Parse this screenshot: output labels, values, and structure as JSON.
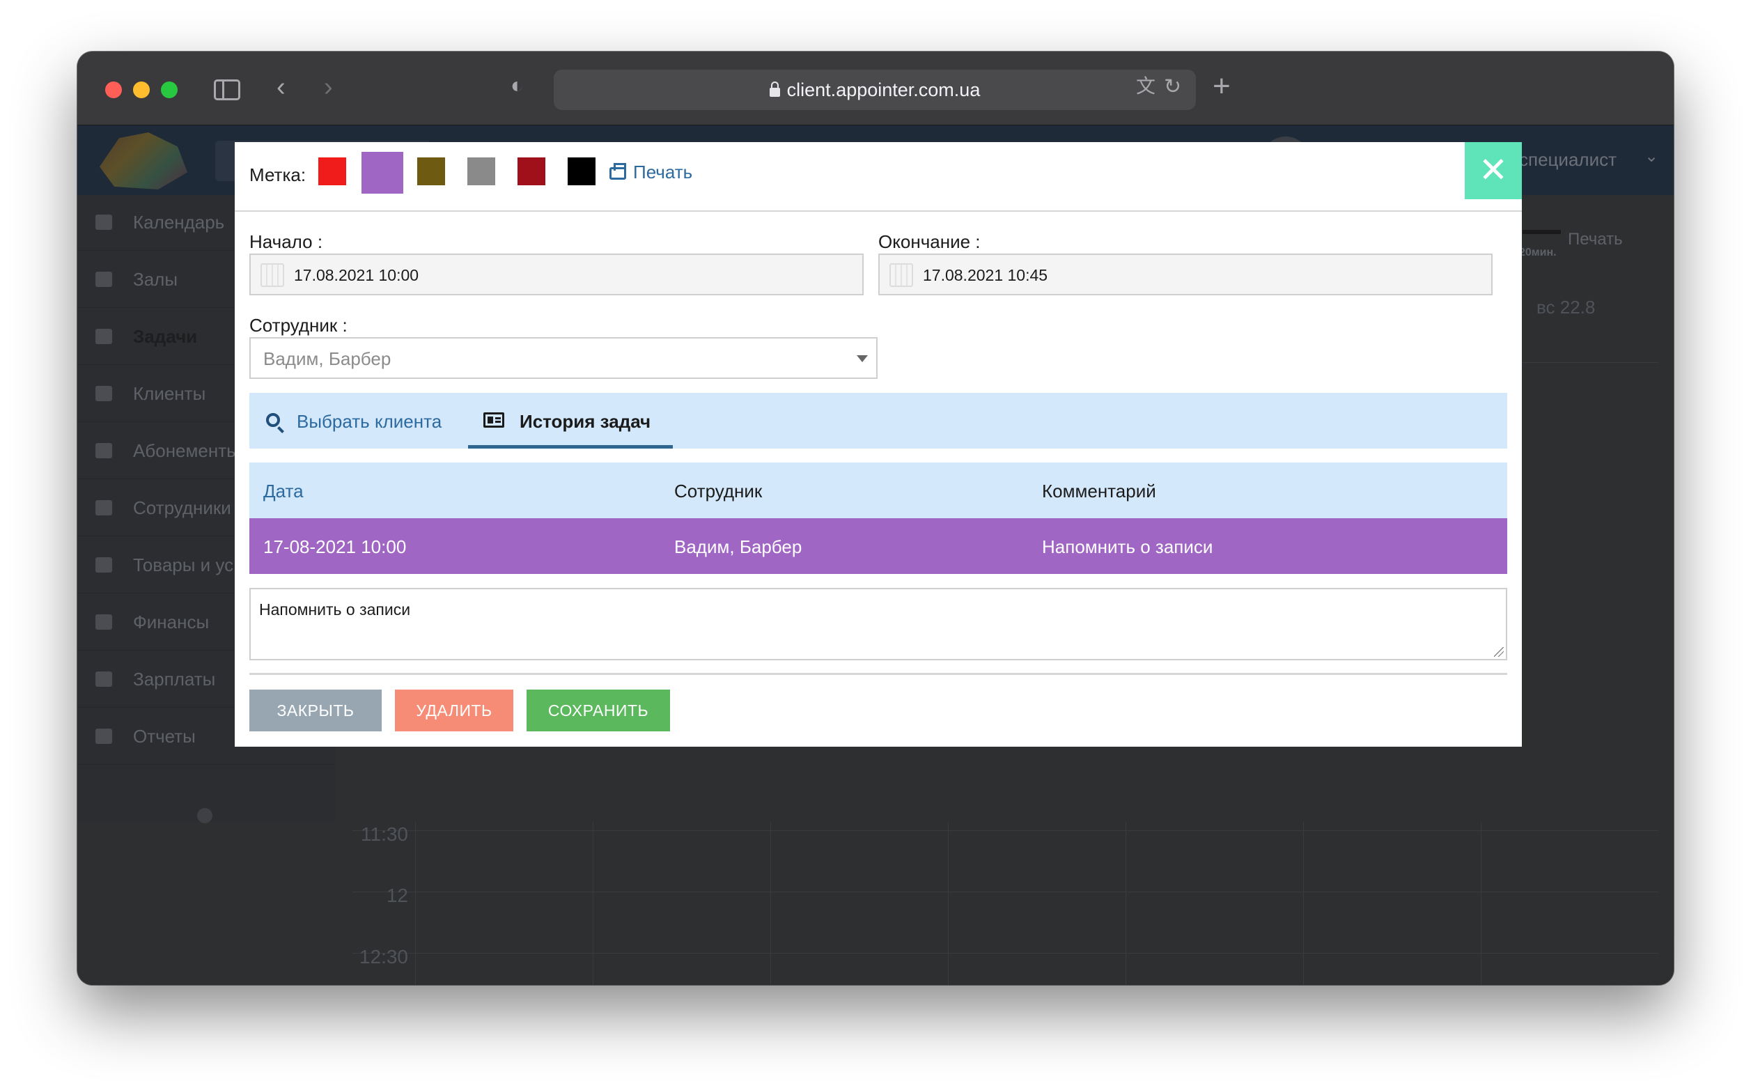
{
  "browser": {
    "url": "client.appointer.com.ua"
  },
  "background_app": {
    "header_role": "специалист",
    "nav_items": [
      {
        "label": "Календарь"
      },
      {
        "label": "Залы"
      },
      {
        "label": "Задачи"
      },
      {
        "label": "Клиенты"
      },
      {
        "label": "Абонементы"
      },
      {
        "label": "Сотрудники"
      },
      {
        "label": "Товары и ус"
      },
      {
        "label": "Финансы"
      },
      {
        "label": "Зарплаты"
      },
      {
        "label": "Отчеты"
      }
    ],
    "active_nav": "Задачи",
    "print_label": "Печать",
    "duration_label": "20мин.",
    "day_label": "вс 22.8",
    "times": [
      "11:30",
      "12",
      "12:30"
    ]
  },
  "modal": {
    "tag_label": "Метка:",
    "swatches": [
      {
        "color": "#f01c1c",
        "selected": false
      },
      {
        "color": "#a066c4",
        "selected": true
      },
      {
        "color": "#6e5a10",
        "selected": false
      },
      {
        "color": "#8a8a8a",
        "selected": false
      },
      {
        "color": "#a0101a",
        "selected": false
      },
      {
        "color": "#000000",
        "selected": false
      }
    ],
    "print_label": "Печать",
    "close_icon": "close-icon",
    "start_label": "Начало :",
    "start_value": "17.08.2021 10:00",
    "end_label": "Окончание :",
    "end_value": "17.08.2021 10:45",
    "employee_label": "Сотрудник :",
    "employee_value": "Вадим, Барбер",
    "tabs": [
      {
        "label": "Выбрать клиента",
        "icon": "search-icon",
        "active": false
      },
      {
        "label": "История задач",
        "icon": "id-card-icon",
        "active": true
      }
    ],
    "history": {
      "columns": [
        "Дата",
        "Сотрудник",
        "Комментарий"
      ],
      "rows": [
        {
          "date": "17-08-2021 10:00",
          "employee": "Вадим, Барбер",
          "comment": "Напомнить о записи"
        }
      ]
    },
    "comment_value": "Напомнить о записи",
    "buttons": {
      "close": "ЗАКРЫТЬ",
      "delete": "УДАЛИТЬ",
      "save": "СОХРАНИТЬ"
    }
  },
  "colors": {
    "accent_tab_bg": "#d3e8fa",
    "selected_row": "#a066c4",
    "close_button": "#5fe3b8",
    "save_button": "#5bb85d",
    "delete_button": "#f68c76",
    "close_action_button": "#98a6b1"
  }
}
